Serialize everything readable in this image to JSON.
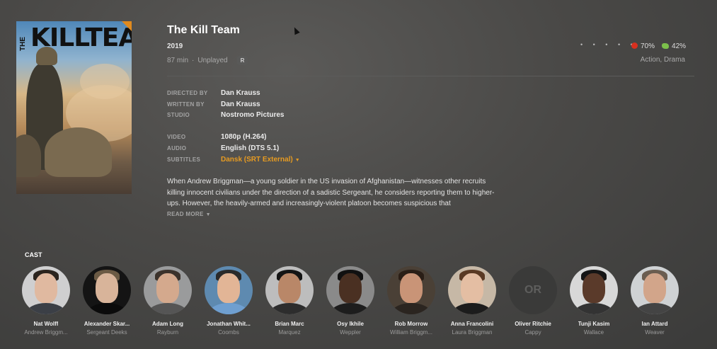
{
  "poster": {
    "title_big": "KILLTEAM",
    "title_small": "THE"
  },
  "movie": {
    "title": "The Kill Team",
    "year": "2019",
    "duration": "87 min",
    "separator": "·",
    "status": "Unplayed",
    "content_rating": "R",
    "stars": "• • • • •",
    "critic_score": "70%",
    "audience_score": "42%",
    "genres": "Action, Drama"
  },
  "details": [
    {
      "label": "DIRECTED BY",
      "value": "Dan Krauss"
    },
    {
      "label": "WRITTEN BY",
      "value": "Dan Krauss"
    },
    {
      "label": "STUDIO",
      "value": "Nostromo Pictures"
    }
  ],
  "media": [
    {
      "label": "VIDEO",
      "value": "1080p (H.264)"
    },
    {
      "label": "AUDIO",
      "value": "English (DTS 5.1)"
    },
    {
      "label": "SUBTITLES",
      "value": "Dansk (SRT External)"
    }
  ],
  "summary": "When Andrew Briggman—a young soldier in the US invasion of Afghanistan—witnesses other recruits killing innocent civilians under the direction of a sadistic Sergeant, he considers reporting them to higher-ups. However, the heavily-armed and increasingly-violent platoon becomes suspicious that",
  "read_more": "READ MORE",
  "cast_label": "CAST",
  "cast": [
    {
      "name": "Nat Wolff",
      "role": "Andrew Briggm..."
    },
    {
      "name": "Alexander Skar...",
      "role": "Sergeant Deeks"
    },
    {
      "name": "Adam Long",
      "role": "Rayburn"
    },
    {
      "name": "Jonathan Whit...",
      "role": "Coombs"
    },
    {
      "name": "Brian Marc",
      "role": "Marquez"
    },
    {
      "name": "Osy Ikhile",
      "role": "Weppler"
    },
    {
      "name": "Rob Morrow",
      "role": "William Briggm..."
    },
    {
      "name": "Anna Francolini",
      "role": "Laura Briggman"
    },
    {
      "name": "Oliver Ritchie",
      "role": "Cappy",
      "initials": "OR"
    },
    {
      "name": "Tunji Kasim",
      "role": "Wallace"
    },
    {
      "name": "Ian Attard",
      "role": "Weaver"
    }
  ],
  "colors": {
    "accent": "#e79b21",
    "tomato": "#d7301f",
    "splat": "#7cc04b"
  }
}
